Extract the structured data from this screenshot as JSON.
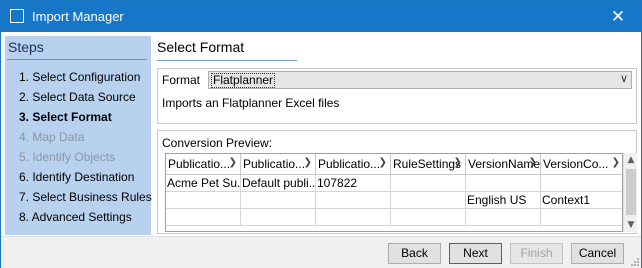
{
  "window": {
    "title": "Import Manager",
    "close_glyph": "✕",
    "accent_color": "#1677c8"
  },
  "steps": {
    "title": "Steps",
    "items": [
      {
        "label": "1. Select Configuration",
        "state": "normal"
      },
      {
        "label": "2. Select Data Source",
        "state": "normal"
      },
      {
        "label": "3. Select Format",
        "state": "active"
      },
      {
        "label": "4. Map Data",
        "state": "disabled"
      },
      {
        "label": "5. Identify Objects",
        "state": "disabled"
      },
      {
        "label": "6. Identify Destination",
        "state": "normal"
      },
      {
        "label": "7. Select Business Rules",
        "state": "normal"
      },
      {
        "label": "8. Advanced Settings",
        "state": "normal"
      }
    ]
  },
  "main": {
    "section_title": "Select Format",
    "format": {
      "label": "Format",
      "selected": "Flatplanner",
      "description": "Imports an Flatplanner Excel files"
    },
    "preview": {
      "label": "Conversion Preview:",
      "columns": [
        "Publicatio...",
        "Publicatio...",
        "Publicatio...",
        "RuleSettings",
        "VersionName",
        "VersionCo..."
      ],
      "rows": [
        [
          "Acme Pet Su...",
          "Default publi...",
          "107822",
          "",
          "",
          ""
        ],
        [
          "",
          "",
          "",
          "",
          "English US",
          "Context1"
        ],
        [
          "",
          "",
          "",
          "",
          "",
          ""
        ]
      ]
    }
  },
  "footer": {
    "back_label": "Back",
    "next_label": "Next",
    "finish_label": "Finish",
    "cancel_label": "Cancel"
  }
}
